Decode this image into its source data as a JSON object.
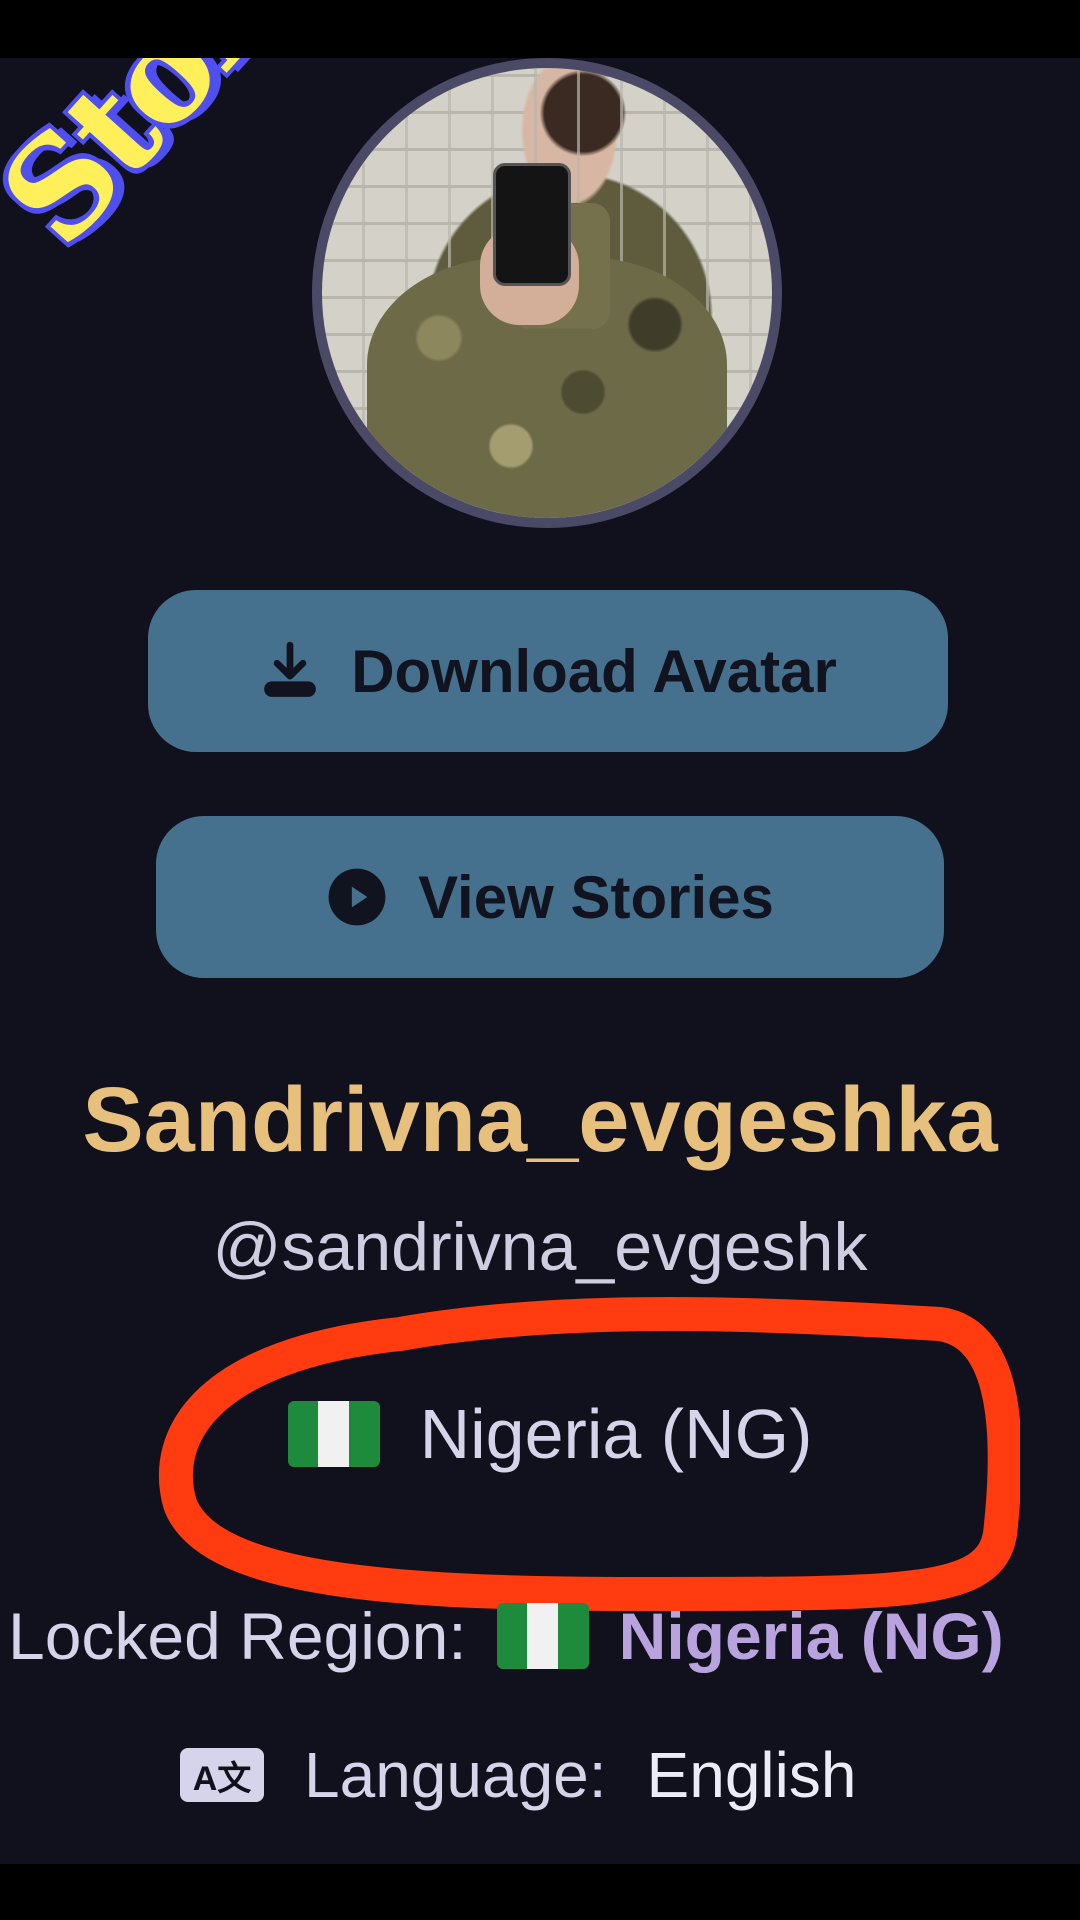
{
  "overlay": {
    "text": "Stolen"
  },
  "buttons": {
    "download": {
      "label": "Download Avatar",
      "icon": "download-icon"
    },
    "stories": {
      "label": "View Stories",
      "icon": "play-circle-icon"
    }
  },
  "profile": {
    "display_name": "Sandrivna_evgeshka",
    "handle": "@sandrivna_evgeshk",
    "country": "Nigeria (NG)",
    "country_flag": "nigeria-flag-icon"
  },
  "locked_region": {
    "label": "Locked Region:",
    "value": "Nigeria (NG)",
    "flag": "nigeria-flag-icon"
  },
  "language": {
    "icon_text": "A文",
    "label": "Language:",
    "value": "English"
  },
  "colors": {
    "background": "#11111d",
    "button": "#45718e",
    "display_name": "#e8c07d",
    "locked_value": "#b8a3df",
    "annotation": "#ff3b0f"
  }
}
